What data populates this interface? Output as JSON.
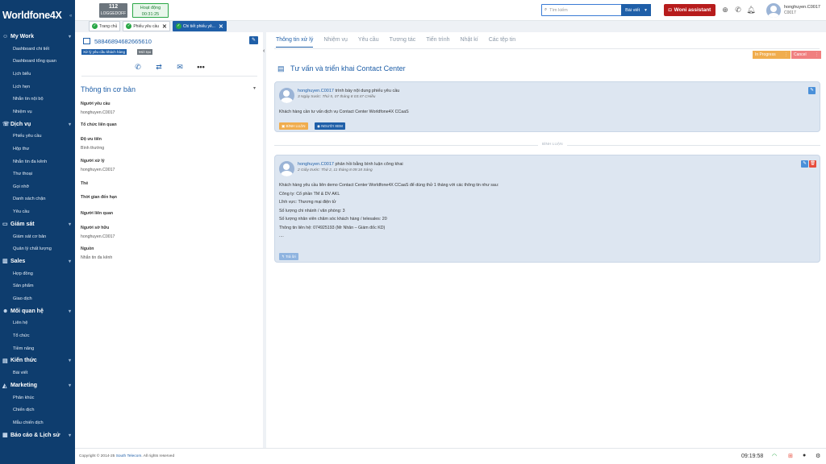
{
  "brand": "Worldfone4X",
  "sidebar": {
    "sections": [
      {
        "label": "My Work",
        "icon": "user-icon",
        "items": [
          "Dashboard chi tiết",
          "Dashboard tổng quan",
          "Lịch biểu",
          "Lịch hẹn",
          "Nhắn tin nội bộ",
          "Nhiệm vụ"
        ]
      },
      {
        "label": "Dịch vụ",
        "icon": "headset-icon",
        "items": [
          "Phiếu yêu cầu",
          "Hộp thư",
          "Nhắn tin đa kênh",
          "Thư thoại",
          "Gọi nhỡ",
          "Danh sách chặn",
          "Yêu cầu"
        ]
      },
      {
        "label": "Giám sát",
        "icon": "monitor-icon",
        "items": [
          "Giám sát cơ bản",
          "Quản lý chất lượng"
        ]
      },
      {
        "label": "Sales",
        "icon": "chart-icon",
        "items": [
          "Hợp đồng",
          "Sản phẩm",
          "Giao dịch"
        ]
      },
      {
        "label": "Mối quan hệ",
        "icon": "people-icon",
        "items": [
          "Liên hệ",
          "Tổ chức",
          "Tiềm năng"
        ]
      },
      {
        "label": "Kiến thức",
        "icon": "book-icon",
        "items": [
          "Bài viết"
        ]
      },
      {
        "label": "Marketing",
        "icon": "megaphone-icon",
        "items": [
          "Phân khúc",
          "Chiến dịch",
          "Mẫu chiến dịch"
        ]
      },
      {
        "label": "Báo cáo & Lịch sử",
        "icon": "report-icon",
        "items": []
      }
    ]
  },
  "topbar": {
    "extension": "112",
    "extension_status": "LOGGEDOFF",
    "activity_label": "Hoạt động",
    "activity_time": "00:31:25",
    "search_placeholder": "Tìm kiếm",
    "search_type": "Bài viết",
    "woni_label": "Woni assistant",
    "user_name": "honghuyen.C0017",
    "user_code": "C0017"
  },
  "tabs": [
    {
      "label": "Trang chủ",
      "active": false,
      "closable": false
    },
    {
      "label": "Phiếu yêu cầu",
      "active": false,
      "closable": true
    },
    {
      "label": "Chi tiết phiếu yê...",
      "active": true,
      "closable": true
    }
  ],
  "ticket": {
    "id": "58846894682665610",
    "tag_type": "Xử lý yêu cầu khách hàng",
    "tag_status": "Mới tạo",
    "section_title": "Thông tin cơ bản",
    "fields": [
      {
        "label": "Người yêu cầu",
        "value": "honghuyen.C0017"
      },
      {
        "label": "Tổ chức liên quan",
        "value": ""
      },
      {
        "label": "Độ ưu tiên",
        "value": "Bình thường"
      },
      {
        "label": "Người xử lý",
        "value": "honghuyen.C0017"
      },
      {
        "label": "Thẻ",
        "value": ""
      },
      {
        "label": "Thời gian đến hạn",
        "value": ""
      },
      {
        "label": "Người liên quan",
        "value": ""
      },
      {
        "label": "Người sở hữu",
        "value": "honghuyen.C0017"
      },
      {
        "label": "Nguồn",
        "value": "Nhắn tin đa kênh"
      }
    ]
  },
  "detail": {
    "tabs": [
      "Thông tin xử lý",
      "Nhiệm vụ",
      "Yêu cầu",
      "Tương tác",
      "Tiến trình",
      "Nhật kí",
      "Các tệp tin"
    ],
    "btn_progress": "In Progress",
    "btn_cancel": "Cancel",
    "title": "Tư vấn và triển khai Contact Center",
    "post": {
      "user": "honghuyen.C0017",
      "action": "trình bày nội dung phiếu yêu cầu",
      "meta": "3 Ngày trước: Thứ 5, 07 tháng 8 03:47 CHiều",
      "body": "Khách hàng cần tư vấn dịch vụ Contact Center Worldfone4X CCaaS",
      "btn_comment": "BÌNH LUẬN",
      "btn_viewers": "NGƯỜI XEM"
    },
    "separator": "BÌNH LUẬN",
    "comment": {
      "user": "honghuyen.C0017",
      "action": "phản hồi bằng bình luận công khai",
      "meta": "2 Giây trước: Thứ 2, 11 tháng 8 09:18 Sáng",
      "lines": [
        "Khách hàng yêu cầu liên demo Contact Center Worldfone4X CCaaS để dùng thử 1 tháng với các thông tin như sau:",
        "Công ty: Cổ phần TM & DV AKL",
        "Lĩnh vực: Thương mại điện tử",
        "Số lượng chi nhánh / văn phòng: 3",
        "Số lượng nhân viên chăm sóc khách hàng / telesales: 20",
        "Thông tin liên hệ: 074925193 (Mr Nhân – Giám đốc KD)",
        "...."
      ],
      "btn_reply": "Trả lời"
    }
  },
  "footer": {
    "copyright": "Copyright © 2014-25",
    "company": "South Telecom",
    "rights": ". All rights reserved",
    "clock": "09:19:58"
  }
}
